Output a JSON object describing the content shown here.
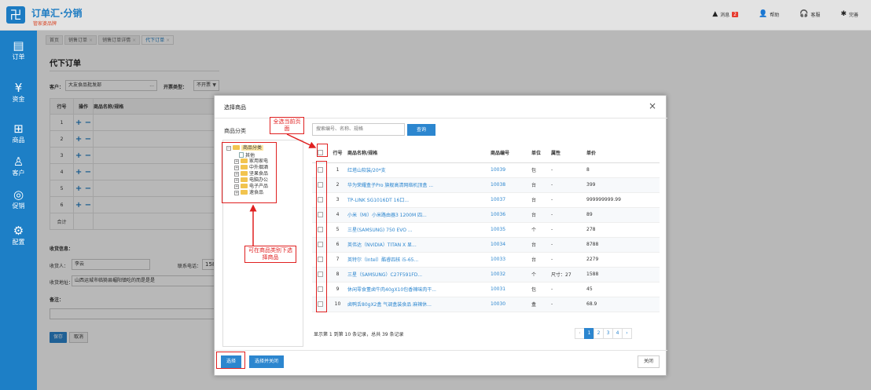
{
  "header": {
    "app_title": "订单汇·分销",
    "app_subtitle": "管家婆品牌",
    "logo_glyph": "卍",
    "right_items": [
      {
        "icon": "bell-icon",
        "glyph": "▲",
        "label": "消息",
        "badge": "2"
      },
      {
        "icon": "user-icon",
        "glyph": "👤",
        "label": "帮助"
      },
      {
        "icon": "headset-icon",
        "glyph": "🎧",
        "label": "客服"
      },
      {
        "icon": "gear-icon",
        "glyph": "✱",
        "label": "完善"
      }
    ]
  },
  "sidebar": {
    "items": [
      {
        "icon": "document-icon",
        "glyph": "▤",
        "label": "订单"
      },
      {
        "icon": "money-icon",
        "glyph": "¥",
        "label": "资金"
      },
      {
        "icon": "gift-icon",
        "glyph": "⊞",
        "label": "商品"
      },
      {
        "icon": "person-icon",
        "glyph": "♙",
        "label": "客户"
      },
      {
        "icon": "promo-icon",
        "glyph": "◎",
        "label": "促销"
      },
      {
        "icon": "settings-icon",
        "glyph": "⚙",
        "label": "配置"
      }
    ]
  },
  "tabs": [
    {
      "label": "首页",
      "closable": false
    },
    {
      "label": "销售订单",
      "closable": true
    },
    {
      "label": "销售订单详情",
      "closable": true
    },
    {
      "label": "代下订单",
      "closable": true,
      "active": true
    }
  ],
  "main": {
    "page_title": "代下订单",
    "customer_label": "客户：",
    "customer_value": "大友食品批发部",
    "customer_btn": "...",
    "invoice_label": "开票类型：",
    "invoice_value": "不开票",
    "table_headers": [
      "行号",
      "操作",
      "商品名称/规格"
    ],
    "rows": [
      "1",
      "2",
      "3",
      "4",
      "5",
      "6"
    ],
    "ops_glyph": "+ −",
    "total_label": "合计",
    "receive_info_label": "收货信息：",
    "receiver_label": "收货人：",
    "receiver_value": "李云",
    "phone_label": "联系电话：",
    "phone_value": "15882",
    "address_label": "收货地址：",
    "address_value": "山西运城市临猗县嵋阳镇吃的而是是是",
    "remark_label": "备注：",
    "save_label": "保存",
    "cancel_label": "取消"
  },
  "modal": {
    "title": "选择商品",
    "close_glyph": "×",
    "category_label": "商品分类",
    "tree": [
      {
        "label": "商品分类",
        "level": 0,
        "expander": "⊟",
        "root": true
      },
      {
        "label": "其他",
        "level": 1,
        "expander": "",
        "file": true
      },
      {
        "label": "家用家电",
        "level": 1,
        "expander": "+"
      },
      {
        "label": "中外烟酒",
        "level": 1,
        "expander": "+"
      },
      {
        "label": "坚果食品",
        "level": 1,
        "expander": "+"
      },
      {
        "label": "电脑办公",
        "level": 1,
        "expander": "+"
      },
      {
        "label": "电子产品",
        "level": 1,
        "expander": "+"
      },
      {
        "label": "速食品",
        "level": 1,
        "expander": "+"
      }
    ],
    "search_placeholder": "搜索编号、名称、规格",
    "search_button": "查询",
    "columns": [
      "行号",
      "商品名称/规格",
      "商品编号",
      "单位",
      "属性",
      "单价"
    ],
    "products": [
      {
        "row": "1",
        "name": "红塔山软装/20*支",
        "code": "10039",
        "unit": "包",
        "attr": "-",
        "price": "8"
      },
      {
        "row": "2",
        "name": "华为荣耀盒子Pro 旗舰高清网络机顶盒 ...",
        "code": "10038",
        "unit": "台",
        "attr": "-",
        "price": "399"
      },
      {
        "row": "3",
        "name": "TP-LINK SG1016DT 16口...",
        "code": "10037",
        "unit": "台",
        "attr": "-",
        "price": "999999999.99"
      },
      {
        "row": "4",
        "name": "小米（MI）小米路由器3 1200M 四...",
        "code": "10036",
        "unit": "台",
        "attr": "-",
        "price": "89"
      },
      {
        "row": "5",
        "name": "三星(SAMSUNG) 750 EVO ...",
        "code": "10035",
        "unit": "个",
        "attr": "-",
        "price": "278"
      },
      {
        "row": "6",
        "name": "英伟达（NVIDIA）TITAN X 显...",
        "code": "10034",
        "unit": "台",
        "attr": "-",
        "price": "8788"
      },
      {
        "row": "7",
        "name": "英特尔（Intel）酷睿四核 i5-65...",
        "code": "10033",
        "unit": "台",
        "attr": "-",
        "price": "2279"
      },
      {
        "row": "8",
        "name": "三星（SAMSUNG）C27F591FD...",
        "code": "10032",
        "unit": "个",
        "attr": "尺寸：27",
        "price": "1588"
      },
      {
        "row": "9",
        "name": "休闲零食董卤牛肉40gX10包香辣味肉干...",
        "code": "10031",
        "unit": "包",
        "attr": "-",
        "price": "45"
      },
      {
        "row": "10",
        "name": "卤鸭舌80gX2盒 气调盒装食品 麻辣休...",
        "code": "10030",
        "unit": "盒",
        "attr": "-",
        "price": "68.9"
      }
    ],
    "pager_text": "显示第 1 到第 10 条记录，总共 39 条记录",
    "pages": [
      "‹",
      "1",
      "2",
      "3",
      "4",
      "›"
    ],
    "select_button": "选择",
    "select_close_button": "选择并关闭",
    "close_button": "关闭"
  },
  "annotations": {
    "select_all_note": "全选当前页面",
    "category_note": "可在商品类别下选择商品",
    "color": "#e02020"
  },
  "colors": {
    "brand": "#1c7bc2",
    "sidebar": "#1d7fc6",
    "button": "#2c86cf"
  }
}
